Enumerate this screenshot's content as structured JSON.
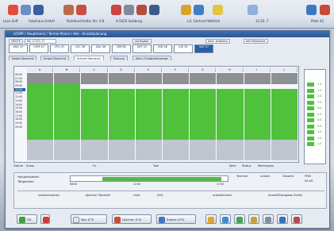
{
  "toolbar": {
    "labels": [
      "Loco-Soft",
      "Autohaus GmbH",
      "Paintbuchhalter Str. 4-8",
      "A-5020 Salzburg",
      "LA, Gerhard Wettlich",
      "12.03..7",
      "Platz 42"
    ]
  },
  "window": {
    "title": "LOSP9 / Hauptmenü / Termin-Planer / Alle - Einsatzplanung",
    "heute": "HEUTE",
    "date": "Mo 27.02.17",
    "verfuegbar": "verfügbar",
    "buttons": {
      "sort_arbeiten": "Sort. Arbeiten",
      "alle_monteure": "alle Monteure"
    },
    "days": [
      "ANG 25",
      "COM 43",
      "CPU 47",
      "CSC 38",
      "DAL 46",
      "DIR 66",
      "DEF 22",
      "JGD 48",
      "JUK 35",
      "SAP 57"
    ],
    "tabs": [
      "Detail-Übersicht",
      "Ampel-Übersicht",
      "Schnell-Übersicht",
      "Planung",
      "Alles / Einsatzfahrzeuge"
    ],
    "columns": [
      "A",
      "B",
      "C",
      "D",
      "E",
      "F",
      "G",
      "H",
      "I",
      "J"
    ],
    "times": [
      "06:00",
      "07:00",
      "08:00",
      "09:00",
      "10:00",
      "11:00",
      "12:00",
      "13:00",
      "14:00",
      "15:00",
      "16:00",
      "17:00",
      "18:00",
      "19:00",
      "20:00"
    ],
    "side_values": [
      "1.5",
      "1.5",
      "2.0",
      "3.5",
      "4.0",
      "2.5",
      "4.5",
      "3.0",
      "3.5",
      "1.5",
      "1.0"
    ],
    "footer_labels": {
      "datum": "Datum",
      "ausw": "Ausw.",
      "fz": "Fz.",
      "tool": "Tool",
      "wert": "Wert",
      "status": "Status",
      "markungen": "Markungen"
    },
    "bottom": {
      "hauptarbeiten": "Hauptarbeiten",
      "taetigkeiten": "Tätigkeiten",
      "time_start": "08:00",
      "time_mid": "12:00",
      "time_end": "17:00",
      "termine": "Termine",
      "unbezl": "unbezl.",
      "gesamt": "Gesamt",
      "frei": "FREI",
      "frei_value": "04:00",
      "options": [
        "nebeneinander",
        "gleicher Startzeit",
        "Liste",
        "Zeit",
        "unbestimmte",
        "Anzahl/Rückgabe Zeilen"
      ]
    },
    "buttons_bar": [
      "OK",
      "Neu (F3)",
      "Löschen (F4)",
      "Ändern (F5)"
    ]
  }
}
